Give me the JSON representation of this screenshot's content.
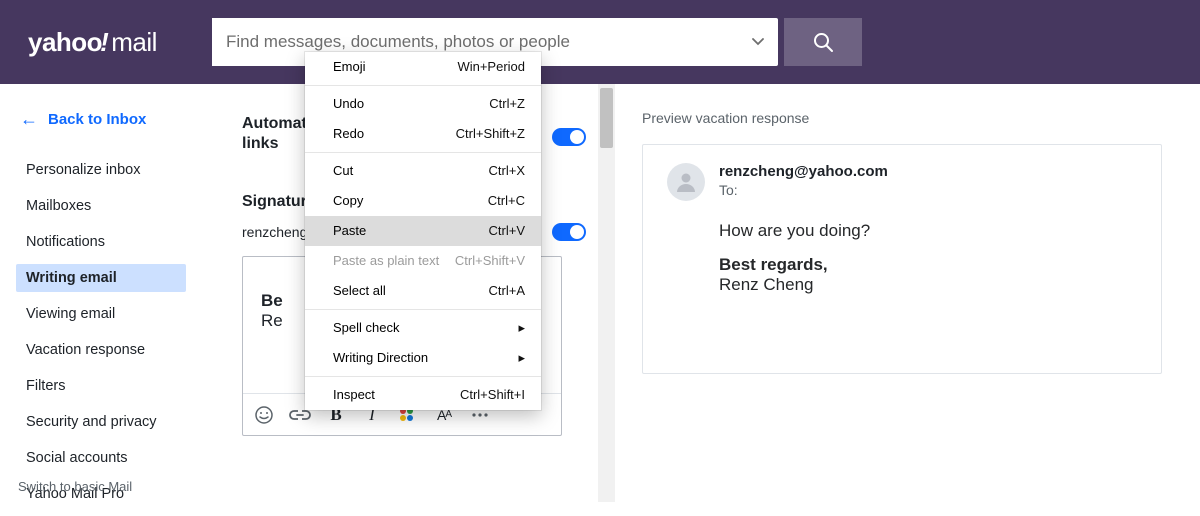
{
  "logo": {
    "brand": "yahoo",
    "suffix": "mail"
  },
  "search": {
    "placeholder": "Find messages, documents, photos or people",
    "value": ""
  },
  "sidebar": {
    "back_label": "Back to Inbox",
    "items": [
      {
        "label": "Personalize inbox"
      },
      {
        "label": "Mailboxes"
      },
      {
        "label": "Notifications"
      },
      {
        "label": "Writing email"
      },
      {
        "label": "Viewing email"
      },
      {
        "label": "Vacation response"
      },
      {
        "label": "Filters"
      },
      {
        "label": "Security and privacy"
      },
      {
        "label": "Social accounts"
      },
      {
        "label": "Yahoo Mail Pro"
      }
    ],
    "active_index": 3,
    "switch_basic": "Switch to basic Mail"
  },
  "settings": {
    "auto_links": {
      "title_line1": "Automat",
      "title_line2": "links",
      "enabled": true
    },
    "signature_heading": "Signatur",
    "signature_user": "renzcheng",
    "signature_enabled": true,
    "editor": {
      "line1": "Be",
      "line2": "Re"
    }
  },
  "context_menu": {
    "items": [
      {
        "label": "Emoji",
        "shortcut": "Win+Period",
        "disabled": false
      },
      {
        "sep": true
      },
      {
        "label": "Undo",
        "shortcut": "Ctrl+Z",
        "disabled": false
      },
      {
        "label": "Redo",
        "shortcut": "Ctrl+Shift+Z",
        "disabled": false
      },
      {
        "sep": true
      },
      {
        "label": "Cut",
        "shortcut": "Ctrl+X",
        "disabled": false
      },
      {
        "label": "Copy",
        "shortcut": "Ctrl+C",
        "disabled": false
      },
      {
        "label": "Paste",
        "shortcut": "Ctrl+V",
        "disabled": false,
        "hover": true
      },
      {
        "label": "Paste as plain text",
        "shortcut": "Ctrl+Shift+V",
        "disabled": true
      },
      {
        "label": "Select all",
        "shortcut": "Ctrl+A",
        "disabled": false
      },
      {
        "sep": true
      },
      {
        "label": "Spell check",
        "submenu": true
      },
      {
        "label": "Writing Direction",
        "submenu": true
      },
      {
        "sep": true
      },
      {
        "label": "Inspect",
        "shortcut": "Ctrl+Shift+I",
        "disabled": false
      }
    ]
  },
  "preview": {
    "title": "Preview vacation response",
    "from": "renzcheng@yahoo.com",
    "to_label": "To:",
    "body_line1": "How are you doing?",
    "body_line2": "Best regards,",
    "body_line3": "Renz Cheng"
  }
}
